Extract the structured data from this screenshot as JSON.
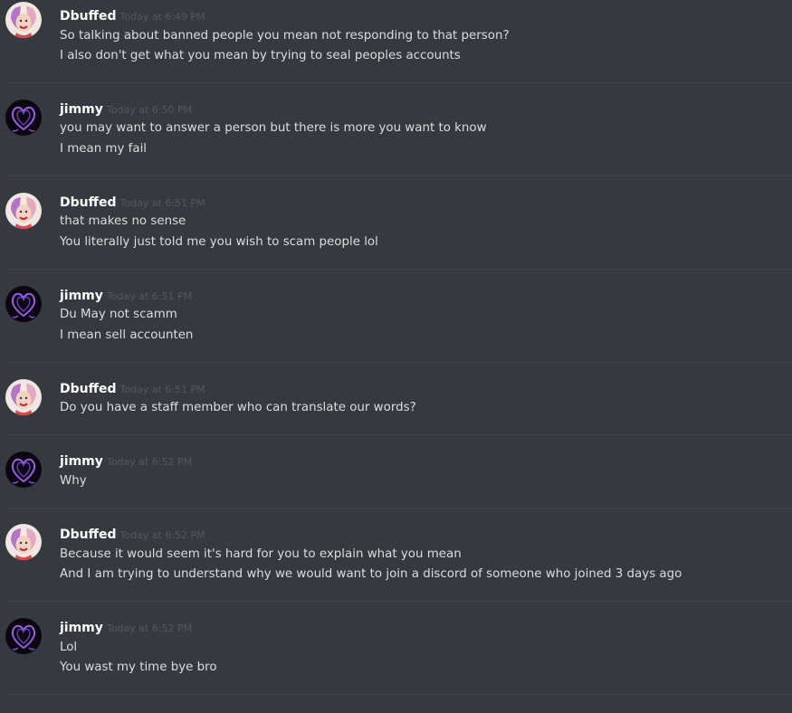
{
  "messages": [
    {
      "author": "Dbuffed",
      "timestamp": "Today at 6:49 PM",
      "avatar": "harley-avatar",
      "lines": [
        "So talking about banned people you mean not responding to that person?",
        "I also don't get what you mean by trying to seal peoples accounts"
      ]
    },
    {
      "author": "jimmy",
      "timestamp": "Today at 6:50 PM",
      "avatar": "purple-heart-avatar",
      "lines": [
        "you may want to answer a person but there is more you want to know",
        "I mean my fail"
      ]
    },
    {
      "author": "Dbuffed",
      "timestamp": "Today at 6:51 PM",
      "avatar": "harley-avatar",
      "lines": [
        "that makes no sense",
        "You literally just told me you wish to scam people lol"
      ]
    },
    {
      "author": "jimmy",
      "timestamp": "Today at 6:51 PM",
      "avatar": "purple-heart-avatar",
      "lines": [
        "Du May not scamm",
        "I mean sell accounten"
      ]
    },
    {
      "author": "Dbuffed",
      "timestamp": "Today at 6:51 PM",
      "avatar": "harley-avatar",
      "lines": [
        "Do you have a staff member who can translate our words?"
      ]
    },
    {
      "author": "jimmy",
      "timestamp": "Today at 6:52 PM",
      "avatar": "purple-heart-avatar",
      "lines": [
        "Why"
      ]
    },
    {
      "author": "Dbuffed",
      "timestamp": "Today at 6:52 PM",
      "avatar": "harley-avatar",
      "lines": [
        "Because it would seem it's hard for you to explain what you mean",
        "And I am trying to understand why we would want to join a discord of someone who joined 3 days ago"
      ]
    },
    {
      "author": "jimmy",
      "timestamp": "Today at 6:52 PM",
      "avatar": "purple-heart-avatar",
      "lines": [
        "Lol",
        "You wast my time bye bro"
      ]
    }
  ],
  "colors": {
    "background": "#36393f",
    "username": "#ffffff",
    "timestamp": "#55585e",
    "message_text": "#dcddde",
    "divider": "#40434a"
  }
}
